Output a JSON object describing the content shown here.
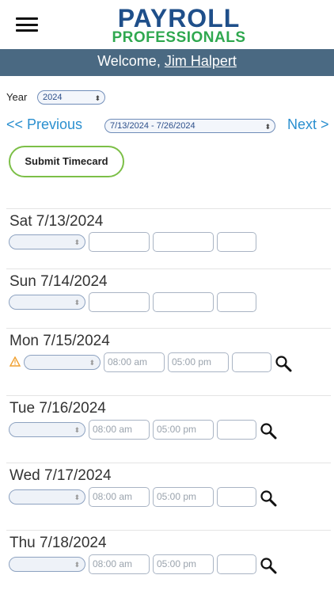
{
  "header": {
    "logo_top": "PAYROLL",
    "logo_bottom": "PROFESSIONALS",
    "welcome_prefix": "Welcome, ",
    "user_name": "Jim Halpert"
  },
  "filters": {
    "year_label": "Year",
    "year_value": "2024",
    "prev_label": "<< Previous",
    "next_label": "Next >",
    "period_value": "7/13/2024 - 7/26/2024"
  },
  "actions": {
    "submit_label": "Submit Timecard"
  },
  "days": [
    {
      "label": "Sat 7/13/2024",
      "start": "",
      "end": "",
      "hours": "",
      "warning": false,
      "search": false
    },
    {
      "label": "Sun 7/14/2024",
      "start": "",
      "end": "",
      "hours": "",
      "warning": false,
      "search": false
    },
    {
      "label": "Mon 7/15/2024",
      "start": "08:00 am",
      "end": "05:00 pm",
      "hours": "",
      "warning": true,
      "search": true
    },
    {
      "label": "Tue 7/16/2024",
      "start": "08:00 am",
      "end": "05:00 pm",
      "hours": "",
      "warning": false,
      "search": true
    },
    {
      "label": "Wed 7/17/2024",
      "start": "08:00 am",
      "end": "05:00 pm",
      "hours": "",
      "warning": false,
      "search": true
    },
    {
      "label": "Thu 7/18/2024",
      "start": "08:00 am",
      "end": "05:00 pm",
      "hours": "",
      "warning": false,
      "search": true
    }
  ],
  "colors": {
    "brand_blue": "#1f4f8a",
    "brand_green": "#2fa84f",
    "banner": "#4a6982",
    "link": "#2a8fcf",
    "submit_border": "#7cbf47",
    "warning": "#f0a030"
  }
}
